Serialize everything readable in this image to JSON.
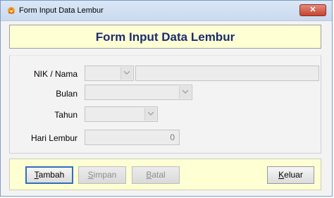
{
  "window": {
    "title": "Form Input Data Lembur"
  },
  "header": {
    "title": "Form Input Data Lembur"
  },
  "form": {
    "nik_label": "NIK / Nama",
    "bulan_label": "Bulan",
    "tahun_label": "Tahun",
    "hari_label": "Hari Lembur",
    "nik_value": "",
    "nama_value": "",
    "bulan_value": "",
    "tahun_value": "",
    "hari_value": "0"
  },
  "buttons": {
    "tambah": {
      "mnemonic": "T",
      "rest": "ambah"
    },
    "simpan": {
      "mnemonic": "S",
      "rest": "impan"
    },
    "batal": {
      "mnemonic": "B",
      "rest": "atal"
    },
    "keluar": {
      "mnemonic": "K",
      "rest": "eluar"
    }
  },
  "colors": {
    "header_bg": "#ffffd4",
    "title_color": "#1c2b6f",
    "focus_border": "#2f6fbf"
  },
  "icons": {
    "app": "app-icon",
    "close": "close-icon"
  }
}
